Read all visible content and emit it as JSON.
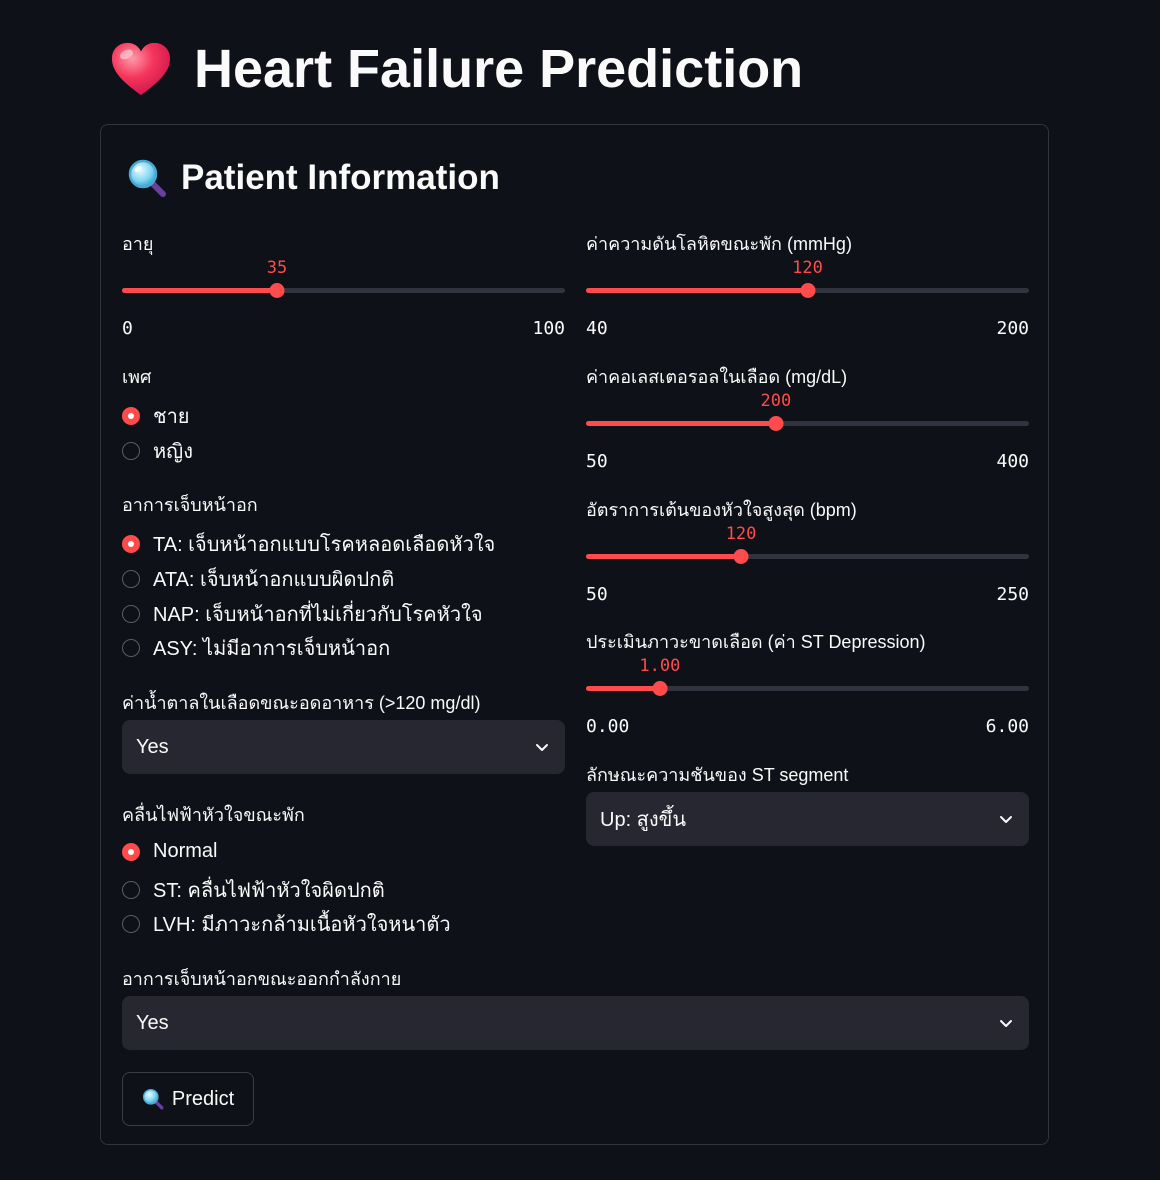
{
  "page": {
    "title": "Heart Failure Prediction",
    "heart_icon": "heart-icon"
  },
  "form": {
    "heading": "Patient Information",
    "heading_icon": "magnifier-icon",
    "age": {
      "label": "อายุ",
      "value": "35",
      "min": "0",
      "max": "100",
      "fraction": 0.35
    },
    "resting_bp": {
      "label": "ค่าความดันโลหิตขณะพัก (mmHg)",
      "value": "120",
      "min": "40",
      "max": "200",
      "fraction": 0.5
    },
    "cholesterol": {
      "label": "ค่าคอเลสเตอรอลในเลือด (mg/dL)",
      "value": "200",
      "min": "50",
      "max": "400",
      "fraction": 0.4286
    },
    "max_hr": {
      "label": "อัตราการเต้นของหัวใจสูงสุด (bpm)",
      "value": "120",
      "min": "50",
      "max": "250",
      "fraction": 0.35
    },
    "oldpeak": {
      "label": "ประเมินภาวะขาดเลือด (ค่า ST Depression)",
      "value": "1.00",
      "min": "0.00",
      "max": "6.00",
      "fraction": 0.1667
    },
    "sex": {
      "label": "เพศ",
      "options": [
        "ชาย",
        "หญิง"
      ],
      "selected": 0
    },
    "chest_pain": {
      "label": "อาการเจ็บหน้าอก",
      "options": [
        "TA: เจ็บหน้าอกแบบโรคหลอดเลือดหัวใจ",
        "ATA: เจ็บหน้าอกแบบผิดปกติ",
        "NAP: เจ็บหน้าอกที่ไม่เกี่ยวกับโรคหัวใจ",
        "ASY: ไม่มีอาการเจ็บหน้าอก"
      ],
      "selected": 0
    },
    "fasting_bs": {
      "label": "ค่าน้ำตาลในเลือดขณะอดอาหาร (>120 mg/dl)",
      "value": "Yes"
    },
    "resting_ecg": {
      "label": "คลื่นไฟฟ้าหัวใจขณะพัก",
      "options": [
        "Normal",
        "ST: คลื่นไฟฟ้าหัวใจผิดปกติ",
        "LVH: มีภาวะกล้ามเนื้อหัวใจหนาตัว"
      ],
      "selected": 0
    },
    "st_slope": {
      "label": "ลักษณะความชันของ ST segment",
      "value": "Up: สูงขึ้น"
    },
    "exercise_angina": {
      "label": "อาการเจ็บหน้าอกขณะออกกำลังกาย",
      "value": "Yes"
    },
    "predict_button": "Predict"
  },
  "colors": {
    "accent": "#ff4b4b",
    "background": "#0e1117",
    "input_bg": "#262730"
  }
}
